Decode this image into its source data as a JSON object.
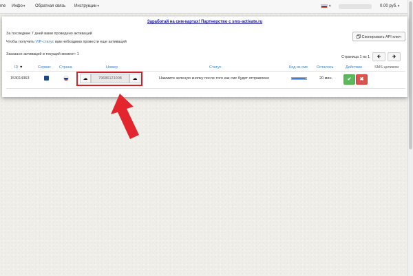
{
  "navbar": {
    "items": [
      {
        "label": "me"
      },
      {
        "label": "Инфо",
        "caret": "▾"
      },
      {
        "label": "Обратная связь"
      },
      {
        "label": "Инструкции",
        "caret": "▾"
      }
    ],
    "flag_caret": "▾",
    "balance": "0.00 руб.",
    "balance_caret": "▾"
  },
  "promo": {
    "text": "Заработай на сим-картах! Партнерство с sms-activate.ru"
  },
  "info": {
    "line1": "За последние 7 дней вами проведено активаций",
    "line2_prefix": "Чтобы получить ",
    "vip_link": "VIP-статус",
    "line2_suffix": " вам небходимо провести еще активаций",
    "ordered": "Заказано активаций в текущий момент: 1"
  },
  "api_button": {
    "label": "Скопировать API ключ",
    "icon": "copy-icon"
  },
  "pagination": {
    "label": "Страница 1 из 1",
    "prev": "🡸",
    "next": "🡺"
  },
  "table": {
    "headers": {
      "id": "ID",
      "service": "Сервис",
      "country": "Страна",
      "number": "Номер",
      "status": "Статус",
      "code": "Код из смс",
      "remaining": "Осталось",
      "action": "Действие",
      "sms_full": "SMS целиком"
    },
    "rows": [
      {
        "id": "153014363",
        "service_icon": "vk-icon",
        "country_icon": "russia-flag-icon",
        "number": "79686121008",
        "status": "Нажмите зеленую кнопку после того как смс будет отправлено",
        "progress": 0.95,
        "remaining": "20 мин.",
        "ok_symbol": "✔",
        "cancel_symbol": "✖"
      }
    ]
  },
  "colors": {
    "accent": "#3a7ec8",
    "promo": "#1a1aa6",
    "highlight": "#d4202a",
    "ok": "#5cb85c",
    "cancel": "#d9534f"
  }
}
